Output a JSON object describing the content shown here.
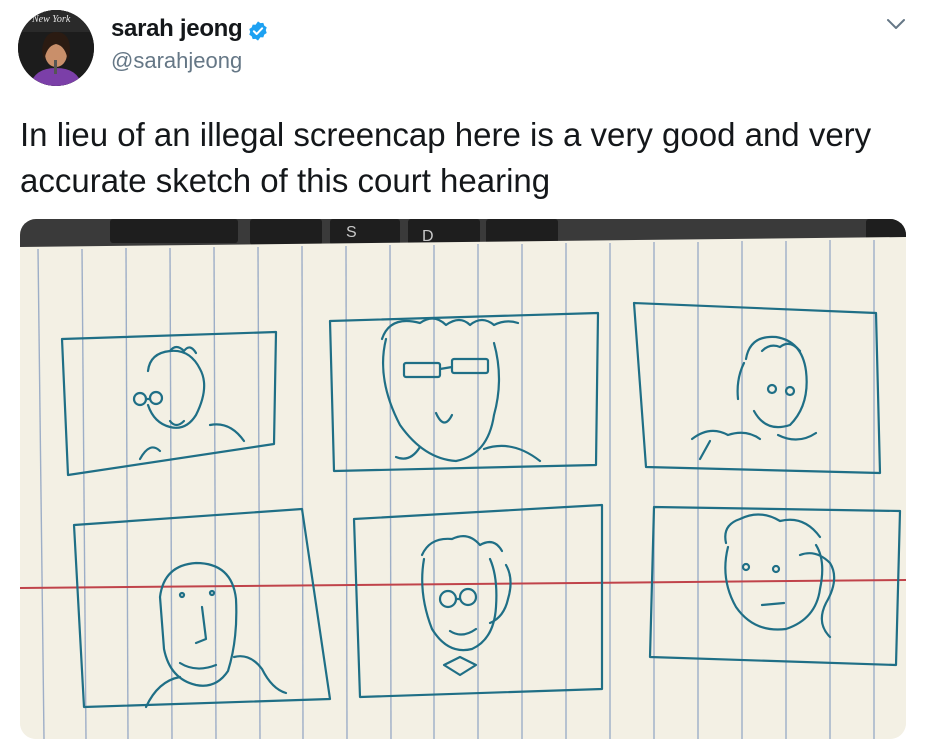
{
  "tweet": {
    "display_name": "sarah jeong",
    "handle": "@sarahjeong",
    "verified": true,
    "avatar_banner": "New York",
    "text": "In lieu of an illegal screencap here is a very good and very accurate sketch of this court hearing"
  },
  "media": {
    "keys": [
      "S",
      "D"
    ],
    "pen_color": "#1f6f86",
    "paper_color": "#f3f0e4",
    "line_color": "#8fa3c2",
    "margin_color": "#c0434a"
  },
  "icons": {
    "verified": "verified-badge-icon",
    "menu": "chevron-down-icon"
  }
}
